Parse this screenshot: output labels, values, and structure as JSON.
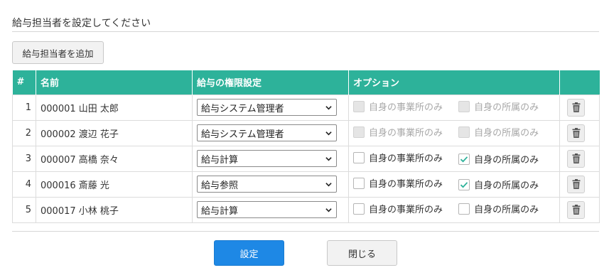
{
  "dialog": {
    "title": "給与担当者を設定してください",
    "add_button_label": "給与担当者を追加",
    "ok_label": "設定",
    "close_label": "閉じる"
  },
  "table": {
    "headers": {
      "no": "#",
      "name": "名前",
      "permission": "給与の権限設定",
      "options": "オプション",
      "action": ""
    },
    "option_labels": {
      "office_only": "自身の事業所のみ",
      "dept_only": "自身の所属のみ"
    },
    "rows": [
      {
        "no": "1",
        "name": "000001 山田 太郎",
        "permission": "給与システム管理者",
        "office_only": false,
        "dept_only": false,
        "options_disabled": true
      },
      {
        "no": "2",
        "name": "000002 渡辺 花子",
        "permission": "給与システム管理者",
        "office_only": false,
        "dept_only": false,
        "options_disabled": true
      },
      {
        "no": "3",
        "name": "000007 高橋 奈々",
        "permission": "給与計算",
        "office_only": false,
        "dept_only": true,
        "options_disabled": false
      },
      {
        "no": "4",
        "name": "000016 斎藤 光",
        "permission": "給与参照",
        "office_only": false,
        "dept_only": true,
        "options_disabled": false
      },
      {
        "no": "5",
        "name": "000017 小林 桃子",
        "permission": "給与計算",
        "office_only": false,
        "dept_only": false,
        "options_disabled": false
      }
    ]
  },
  "colors": {
    "header_bg": "#2db29a",
    "primary": "#1e88e5",
    "check": "#2db29a"
  },
  "icons": {
    "select": "chevron-down-icon",
    "delete": "trash-icon",
    "checked": "checkmark-icon"
  }
}
